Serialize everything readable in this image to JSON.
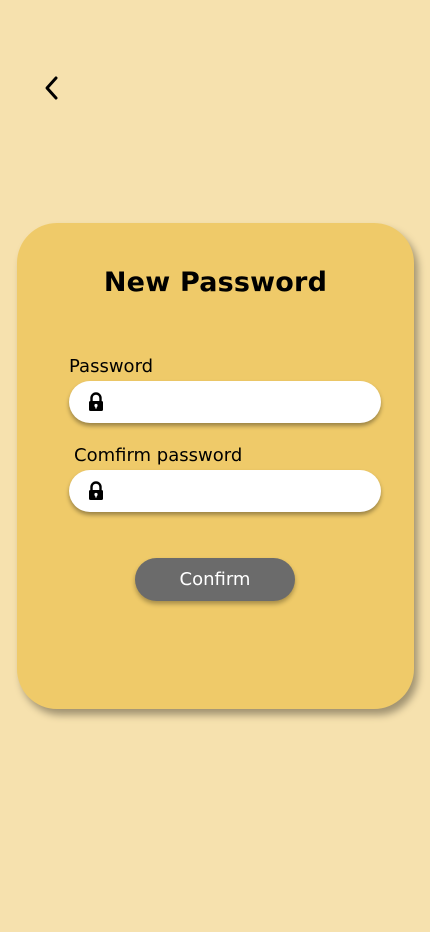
{
  "header": {
    "back_icon": "chevron-left-icon"
  },
  "card": {
    "title": "New Password",
    "password": {
      "label": "Password",
      "value": "",
      "placeholder": "",
      "icon": "lock-icon"
    },
    "confirm_password": {
      "label": "Comfirm password",
      "value": "",
      "placeholder": "",
      "icon": "lock-icon"
    },
    "confirm_button_label": "Confirm"
  },
  "colors": {
    "background": "#f6e1ae",
    "card": "#efca69",
    "button": "#6b6b6b",
    "input": "#ffffff"
  }
}
